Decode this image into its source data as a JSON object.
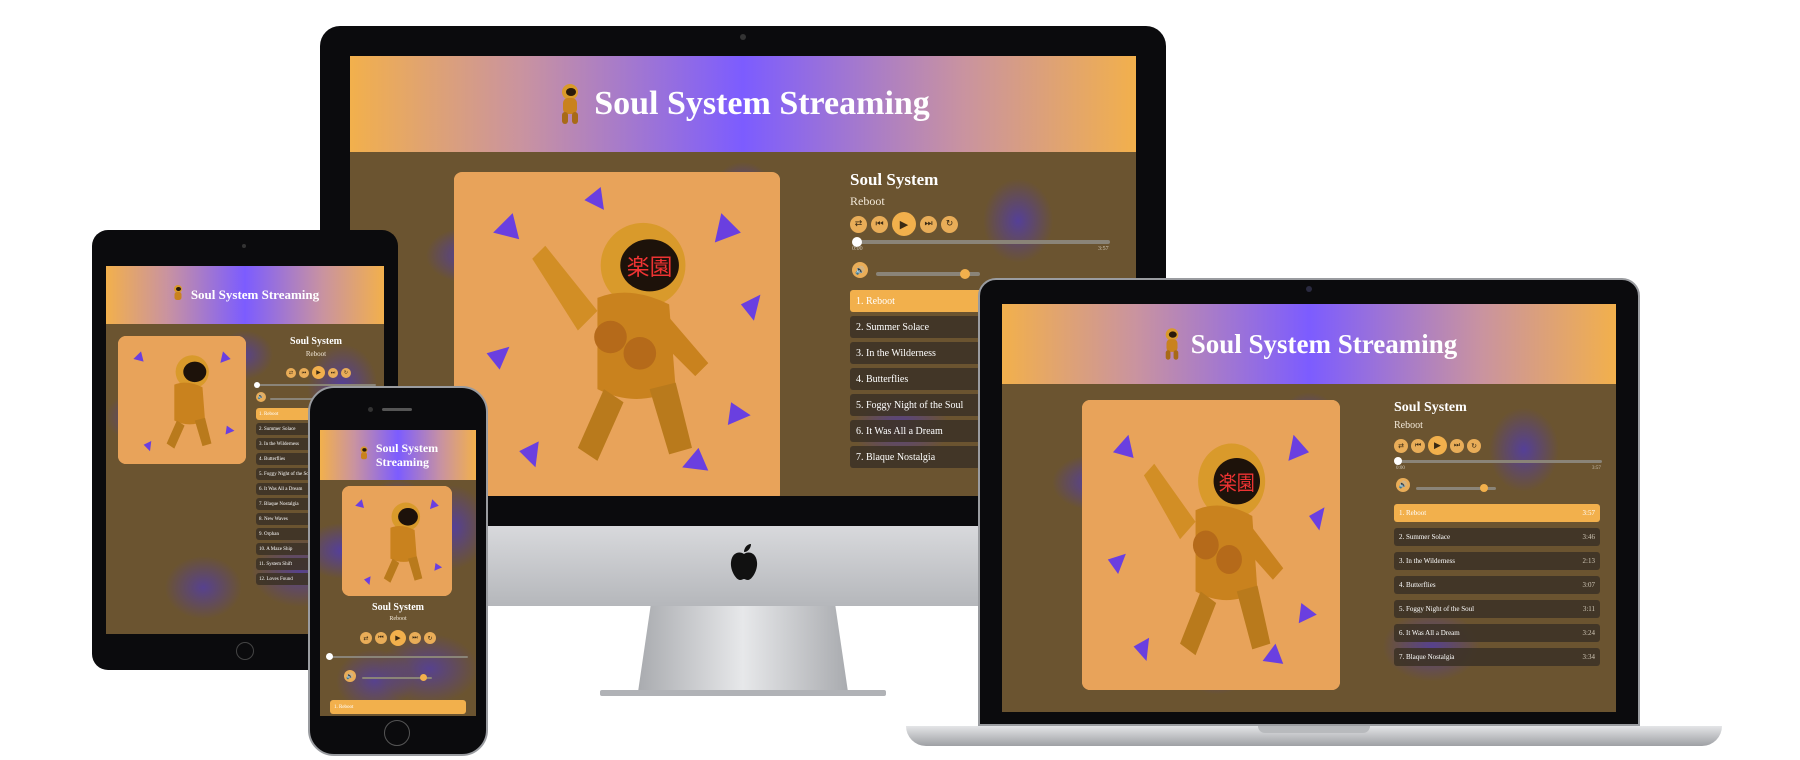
{
  "app": {
    "title": "Soul System Streaming",
    "title_line1": "Soul System",
    "title_line2": "Streaming"
  },
  "now_playing": {
    "artist": "Soul System",
    "track": "Reboot",
    "elapsed": "0:00",
    "duration": "3:57"
  },
  "progress": 0.0,
  "volume": 0.82,
  "controls": {
    "shuffle": "⇄",
    "prev": "⏮",
    "play": "▶",
    "next": "⏭",
    "repeat": "↻",
    "volume": "🔊"
  },
  "tracks": [
    {
      "label": "1. Reboot",
      "time": "3:57"
    },
    {
      "label": "2. Summer Solace",
      "time": "3:46"
    },
    {
      "label": "3. In the Wilderness",
      "time": "2:13"
    },
    {
      "label": "4. Butterflies",
      "time": "3:07"
    },
    {
      "label": "5. Foggy Night of the Soul",
      "time": "3:11"
    },
    {
      "label": "6. It Was All a Dream",
      "time": "3:24"
    },
    {
      "label": "7. Blaque Nostalgia",
      "time": "3:34"
    }
  ],
  "tablet_tracks": [
    "1. Reboot",
    "2. Summer Solace",
    "3. In the Wilderness",
    "4. Butterflies",
    "5. Foggy Night of the Soul",
    "6. It Was All a Dream",
    "7. Blaque Nostalgia",
    "8. New Waves",
    "9. Orphan",
    "10. A Maze Ship",
    "11. System Shift",
    "12. Loves Found"
  ],
  "colors": {
    "accent": "#f2b04c",
    "purple": "#7c5cff",
    "dark_bg": "#6b5430"
  },
  "icons": {
    "logo": "astronaut-icon",
    "apple": "apple-icon"
  }
}
